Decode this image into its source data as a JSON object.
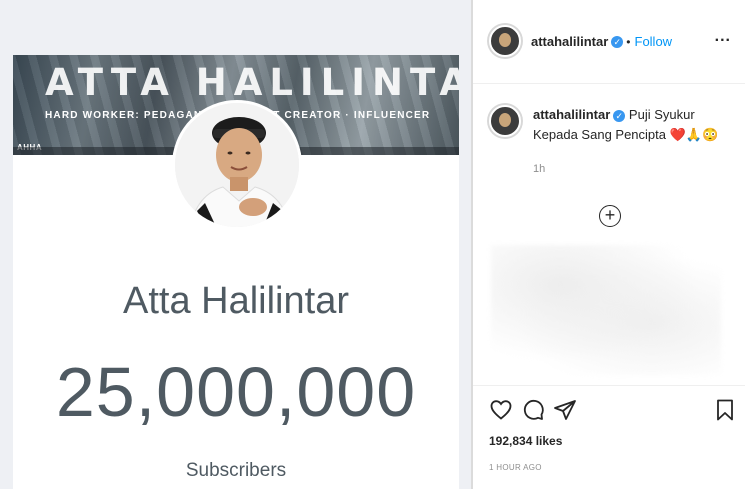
{
  "post_image": {
    "banner": {
      "title": "ATTA HALILINTAR",
      "tagline": "HARD WORKER: PEDAGANG · CONTENT CREATOR · INFLUENCER",
      "logo": "AHHA"
    },
    "channel_name": "Atta Halilintar",
    "subscriber_count": "25,000,000",
    "subscriber_label": "Subscribers"
  },
  "sidebar": {
    "header": {
      "username": "attahalilintar",
      "follow_label": "Follow",
      "more_label": "..."
    },
    "caption": {
      "username": "attahalilintar",
      "text": "Puji Syukur Kepada Sang Pencipta ❤️🙏😳",
      "time": "1h"
    },
    "add_label": "+",
    "likes": "192,834 likes",
    "posted_time": "1 HOUR AGO"
  },
  "colors": {
    "verified": "#3897f0",
    "follow": "#0095f6",
    "youtube_text": "#4f5a62"
  },
  "icons": [
    "heart-icon",
    "comment-icon",
    "share-icon",
    "bookmark-icon",
    "plus-circle-icon",
    "verified-icon",
    "more-icon"
  ]
}
